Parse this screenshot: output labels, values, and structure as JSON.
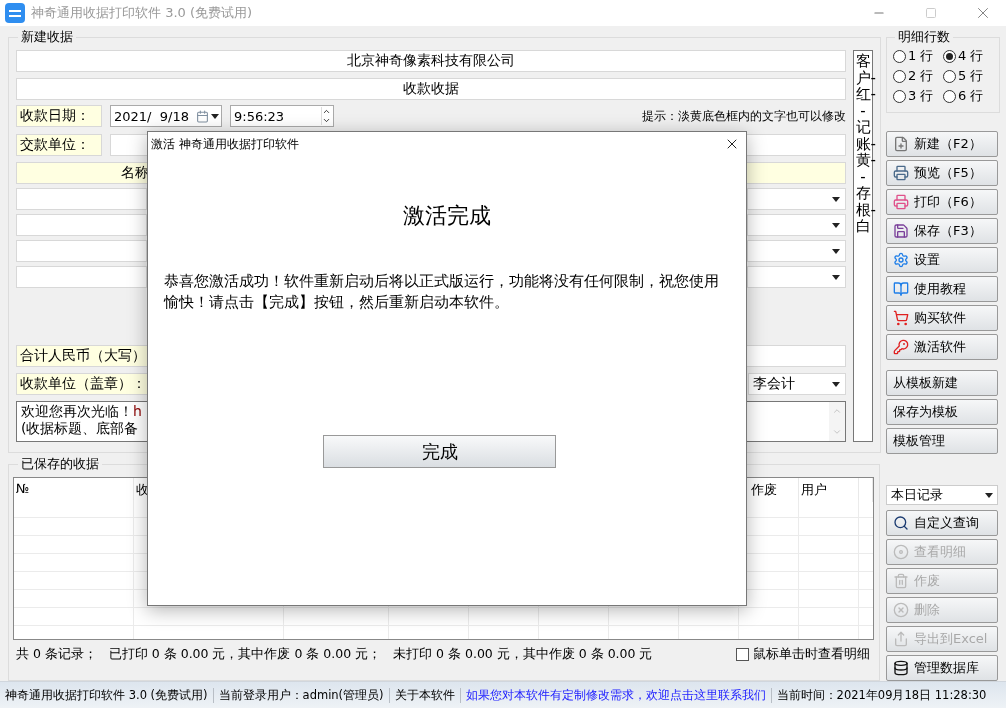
{
  "window": {
    "title": "神奇通用收据打印软件 3.0 (免费试用)"
  },
  "receipt_form": {
    "title": "新建收据",
    "company": "北京神奇像素科技有限公司",
    "receipt_title": "收款收据",
    "date_label": "收款日期：",
    "date": "2021/  9/18",
    "time": "9:56:23",
    "hint": "提示：淡黄底色框内的文字也可以修改",
    "payer_label": "交款单位：",
    "items_header": "名称",
    "total_label": "合计人民币（大写）",
    "payee_label": "收款单位（盖章）：",
    "payee": "李会计",
    "note_lines": [
      {
        "text": "欢迎您再次光临！",
        "link": "h"
      },
      {
        "text": "(收据标题、底部备"
      }
    ],
    "copies_strip": "客户-红--记账-黄--存根-白"
  },
  "detail_rows": {
    "title": "明细行数",
    "options": [
      {
        "label": "1 行",
        "selected": false
      },
      {
        "label": "2 行",
        "selected": false
      },
      {
        "label": "3 行",
        "selected": false
      },
      {
        "label": "4 行",
        "selected": true
      },
      {
        "label": "5 行",
        "selected": false
      },
      {
        "label": "6 行",
        "selected": false
      }
    ]
  },
  "actions": [
    {
      "label": "新建（F2）",
      "disabled": false
    },
    {
      "label": "预览（F5）",
      "disabled": false
    },
    {
      "label": "打印（F6）",
      "disabled": false
    },
    {
      "label": "保存（F3）",
      "disabled": false
    },
    {
      "label": "设置",
      "disabled": false
    },
    {
      "label": "使用教程",
      "disabled": false
    },
    {
      "label": "购买软件",
      "disabled": false
    },
    {
      "label": "激活软件",
      "disabled": false
    }
  ],
  "template_actions": [
    {
      "label": "从模板新建",
      "disabled": false
    },
    {
      "label": "保存为模板",
      "disabled": false
    },
    {
      "label": "模板管理",
      "disabled": false
    }
  ],
  "saved": {
    "title": "已保存的收据",
    "columns": [
      "№",
      "收",
      "作废",
      "用户"
    ],
    "summary": "共 0 条记录；   已打印 0 条 0.00 元，其中作废 0 条 0.00 元；   未打印 0 条 0.00 元，其中作废 0 条 0.00 元",
    "click_to_view": {
      "label": "鼠标单击时查看明细",
      "checked": false
    }
  },
  "filter": "本日记录",
  "query_actions": [
    {
      "label": "自定义查询",
      "disabled": false
    },
    {
      "label": "查看明细",
      "disabled": true
    },
    {
      "label": "作废",
      "disabled": true
    },
    {
      "label": "删除",
      "disabled": true
    },
    {
      "label": "导出到Excel",
      "disabled": true
    },
    {
      "label": "管理数据库",
      "disabled": false
    }
  ],
  "status_bar": [
    {
      "kind": "text",
      "text": "神奇通用收据打印软件 3.0 (免费试用)"
    },
    {
      "kind": "text",
      "text": "当前登录用户：admin(管理员)"
    },
    {
      "kind": "text",
      "text": "关于本软件"
    },
    {
      "kind": "link",
      "text": "如果您对本软件有定制修改需求，欢迎点击这里联系我们"
    },
    {
      "kind": "text",
      "text": "当前时间：2021年09月18日 11:28:30"
    }
  ],
  "dialog": {
    "title": "激活 神奇通用收据打印软件",
    "heading": "激活完成",
    "message": "恭喜您激活成功！软件重新启动后将以正式版运行，功能将没有任何限制，祝您使用愉快！请点击【完成】按钮，然后重新启动本软件。",
    "button": "完成"
  }
}
